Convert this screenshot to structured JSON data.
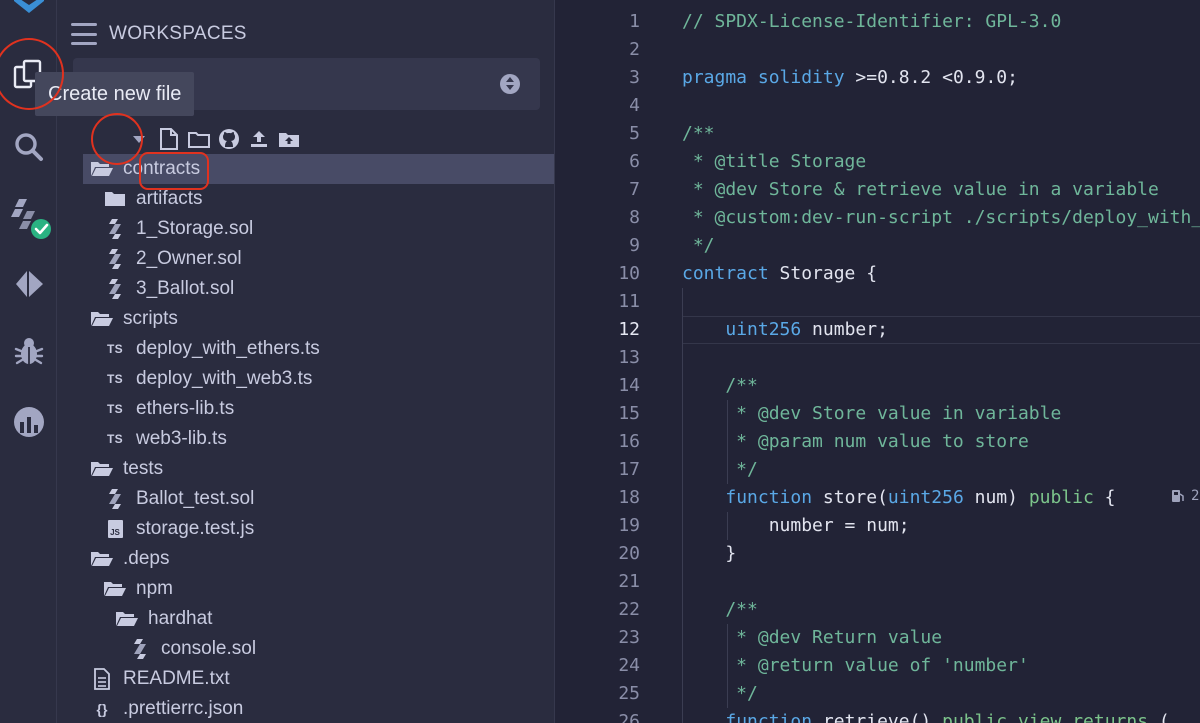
{
  "explorer": {
    "title": "WORKSPACES",
    "tooltip": "Create new file"
  },
  "tree": {
    "items": [
      {
        "label": "contracts",
        "kind": "folder-open",
        "depth": 1,
        "selected": true
      },
      {
        "label": "artifacts",
        "kind": "folder",
        "depth": 2
      },
      {
        "label": "1_Storage.sol",
        "kind": "sol",
        "depth": 2
      },
      {
        "label": "2_Owner.sol",
        "kind": "sol",
        "depth": 2
      },
      {
        "label": "3_Ballot.sol",
        "kind": "sol",
        "depth": 2
      },
      {
        "label": "scripts",
        "kind": "folder-open",
        "depth": 1
      },
      {
        "label": "deploy_with_ethers.ts",
        "kind": "ts",
        "depth": 2
      },
      {
        "label": "deploy_with_web3.ts",
        "kind": "ts",
        "depth": 2
      },
      {
        "label": "ethers-lib.ts",
        "kind": "ts",
        "depth": 2
      },
      {
        "label": "web3-lib.ts",
        "kind": "ts",
        "depth": 2
      },
      {
        "label": "tests",
        "kind": "folder-open",
        "depth": 1
      },
      {
        "label": "Ballot_test.sol",
        "kind": "sol",
        "depth": 2
      },
      {
        "label": "storage.test.js",
        "kind": "js",
        "depth": 2
      },
      {
        "label": ".deps",
        "kind": "folder-open",
        "depth": 1
      },
      {
        "label": "npm",
        "kind": "folder-open",
        "depth": 2
      },
      {
        "label": "hardhat",
        "kind": "folder-open",
        "depth": 3
      },
      {
        "label": "console.sol",
        "kind": "sol",
        "depth": 4
      },
      {
        "label": "README.txt",
        "kind": "txt",
        "depth": 1
      },
      {
        "label": ".prettierrc.json",
        "kind": "json",
        "depth": 1
      }
    ]
  },
  "editor": {
    "active_line": 12,
    "lines": [
      [
        {
          "t": "// SPDX-License-Identifier: GPL-3.0",
          "c": "com"
        }
      ],
      [],
      [
        {
          "t": "pragma",
          "c": "kw"
        },
        {
          "t": " ",
          "c": ""
        },
        {
          "t": "solidity",
          "c": "kw"
        },
        {
          "t": " >=0.8.2 <0.9.0;",
          "c": ""
        }
      ],
      [],
      [
        {
          "t": "/**",
          "c": "com"
        }
      ],
      [
        {
          "t": " * @title Storage",
          "c": "com"
        }
      ],
      [
        {
          "t": " * @dev Store & retrieve value in a variable",
          "c": "com"
        }
      ],
      [
        {
          "t": " * @custom:dev-run-script ./scripts/deploy_with_ethers.ts",
          "c": "com"
        }
      ],
      [
        {
          "t": " */",
          "c": "com"
        }
      ],
      [
        {
          "t": "contract",
          "c": "kw"
        },
        {
          "t": " Storage {",
          "c": ""
        }
      ],
      [],
      [
        {
          "t": "    ",
          "c": ""
        },
        {
          "t": "uint256",
          "c": "kw"
        },
        {
          "t": " number;",
          "c": ""
        }
      ],
      [],
      [
        {
          "t": "    /**",
          "c": "com"
        }
      ],
      [
        {
          "t": "     * @dev Store value in variable",
          "c": "com"
        }
      ],
      [
        {
          "t": "     * @param num value to store",
          "c": "com"
        }
      ],
      [
        {
          "t": "     */",
          "c": "com"
        }
      ],
      [
        {
          "t": "    ",
          "c": ""
        },
        {
          "t": "function",
          "c": "kw"
        },
        {
          "t": " store(",
          "c": ""
        },
        {
          "t": "uint256",
          "c": "kw"
        },
        {
          "t": " num) ",
          "c": ""
        },
        {
          "t": "public",
          "c": "pub"
        },
        {
          "t": " {",
          "c": ""
        }
      ],
      [
        {
          "t": "        number = num;",
          "c": ""
        }
      ],
      [
        {
          "t": "    }",
          "c": ""
        }
      ],
      [],
      [
        {
          "t": "    /**",
          "c": "com"
        }
      ],
      [
        {
          "t": "     * @dev Return value",
          "c": "com"
        }
      ],
      [
        {
          "t": "     * @return value of 'number'",
          "c": "com"
        }
      ],
      [
        {
          "t": "     */",
          "c": "com"
        }
      ],
      [
        {
          "t": "    ",
          "c": ""
        },
        {
          "t": "function",
          "c": "kw"
        },
        {
          "t": " retrieve() ",
          "c": ""
        },
        {
          "t": "public",
          "c": "pub"
        },
        {
          "t": " ",
          "c": ""
        },
        {
          "t": "view",
          "c": "pub"
        },
        {
          "t": " ",
          "c": ""
        },
        {
          "t": "returns",
          "c": "pub"
        },
        {
          "t": " (",
          "c": ""
        }
      ]
    ],
    "gas_label": "2"
  },
  "colors": {
    "accent_annotation": "#e0321f",
    "keyword": "#5aa8e6",
    "comment": "#6fb69a",
    "selection": "#484b66"
  }
}
